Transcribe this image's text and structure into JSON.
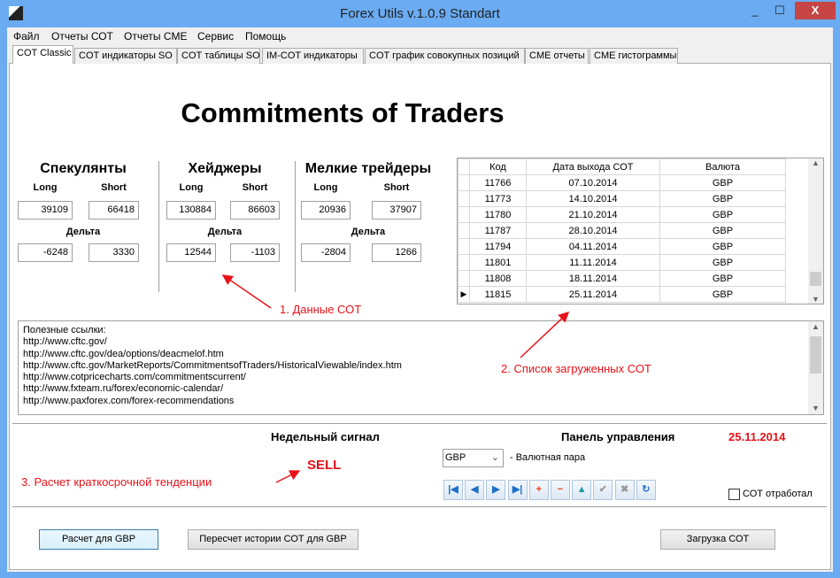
{
  "window": {
    "title": "Forex Utils v.1.0.9 Standart",
    "minimize": "_",
    "maximize": "☐",
    "close": "X"
  },
  "menu": [
    "Файл",
    "Отчеты СОТ",
    "Отчеты CME",
    "Сервис",
    "Помощь"
  ],
  "tabs": [
    "COT  Classic",
    "COT индикаторы SO",
    "COT таблицы SO",
    "IM-COT индикаторы",
    "COT график совокупных позиций",
    "CME отчеты",
    "CME гистограммы"
  ],
  "main_title": "Commitments of Traders",
  "groups": [
    {
      "title": "Спекулянты",
      "long_label": "Long",
      "short_label": "Short",
      "long": "39109",
      "short": "66418",
      "delta_label": "Дельта",
      "delta_long": "-6248",
      "delta_short": "3330"
    },
    {
      "title": "Хейджеры",
      "long_label": "Long",
      "short_label": "Short",
      "long": "130884",
      "short": "86603",
      "delta_label": "Дельта",
      "delta_long": "12544",
      "delta_short": "-1103"
    },
    {
      "title": "Мелкие трейдеры",
      "long_label": "Long",
      "short_label": "Short",
      "long": "20936",
      "short": "37907",
      "delta_label": "Дельта",
      "delta_long": "-2804",
      "delta_short": "1266"
    }
  ],
  "table": {
    "headers": [
      "Код",
      "Дата выхода СОТ",
      "Валюта"
    ],
    "rows": [
      [
        "11766",
        "07.10.2014",
        "GBP"
      ],
      [
        "11773",
        "14.10.2014",
        "GBP"
      ],
      [
        "11780",
        "21.10.2014",
        "GBP"
      ],
      [
        "11787",
        "28.10.2014",
        "GBP"
      ],
      [
        "11794",
        "04.11.2014",
        "GBP"
      ],
      [
        "11801",
        "11.11.2014",
        "GBP"
      ],
      [
        "11808",
        "18.11.2014",
        "GBP"
      ],
      [
        "11815",
        "25.11.2014",
        "GBP"
      ]
    ],
    "current_row_marker": "▶"
  },
  "links": [
    "Полезные ссылки:",
    "http://www.cftc.gov/",
    "http://www.cftc.gov/dea/options/deacmelof.htm",
    "http://www.cftc.gov/MarketReports/CommitmentsofTraders/HistoricalViewable/index.htm",
    "http://www.cotpricecharts.com/commitmentscurrent/",
    "http://www.fxteam.ru/forex/economic-calendar/",
    "http://www.paxforex.com/forex-recommendations"
  ],
  "annotations": {
    "a1": "1. Данные СОТ",
    "a2": "2. Список загруженных СОТ",
    "a3": "3. Расчет краткосрочной тенденции"
  },
  "signal": {
    "label": "Недельный сигнал",
    "value": "SELL"
  },
  "panel": {
    "label": "Панель управления",
    "date": "25.11.2014",
    "pair_value": "GBP",
    "pair_label": "-  Валютная пара",
    "checkbox_label": "СОТ отработал",
    "checked": false
  },
  "toolbar": [
    {
      "name": "first",
      "g": "|◀",
      "c": "#1e6fc8"
    },
    {
      "name": "prev",
      "g": "◀",
      "c": "#1e6fc8"
    },
    {
      "name": "next",
      "g": "▶",
      "c": "#1e6fc8"
    },
    {
      "name": "last",
      "g": "▶|",
      "c": "#1e6fc8"
    },
    {
      "name": "add",
      "g": "+",
      "c": "#e0441a"
    },
    {
      "name": "delete",
      "g": "−",
      "c": "#e0441a"
    },
    {
      "name": "edit",
      "g": "▲",
      "c": "#1a9aa8"
    },
    {
      "name": "post",
      "g": "✔",
      "c": "#999"
    },
    {
      "name": "cancel",
      "g": "✖",
      "c": "#999"
    },
    {
      "name": "refresh",
      "g": "↻",
      "c": "#1e6fc8"
    }
  ],
  "buttons": {
    "calc": "Расчет для GBP",
    "recalc": "Пересчет истории СОТ для GBP",
    "load": "Загрузка СОТ"
  }
}
